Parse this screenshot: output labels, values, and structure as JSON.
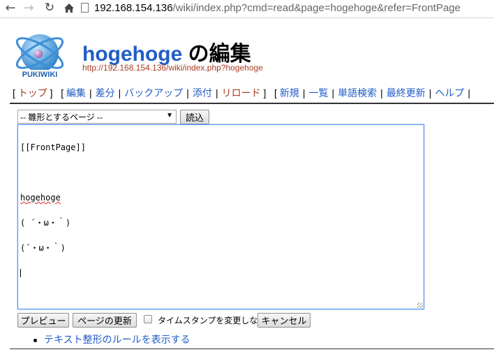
{
  "browser": {
    "url_host": "192.168.154.136",
    "url_rest": "/wiki/index.php?cmd=read&page=hogehoge&refer=FrontPage"
  },
  "header": {
    "page_name": "hogehoge",
    "title_suffix": " の編集",
    "page_url": "http://192.168.154.136/wiki/index.php?hogehoge",
    "logo_text": "PUKIWIKI"
  },
  "navigator": {
    "top": "トップ",
    "group1": [
      "編集",
      "差分",
      "バックアップ",
      "添付",
      "リロード"
    ],
    "group2": [
      "新規",
      "一覧",
      "単語検索",
      "最終更新",
      "ヘルプ"
    ]
  },
  "form": {
    "template_select": "-- 雛形とするページ --",
    "load_button": "読込",
    "textarea_lines": [
      "[[FrontPage]]",
      "",
      "hogehoge",
      "( ´・ω・｀)",
      "(´・ω・｀)"
    ],
    "preview_button": "プレビュー",
    "update_button": "ページの更新",
    "notimestamp_label": "タイムスタンプを変更しない",
    "cancel_button": "キャンセル"
  },
  "rules_link": "テキスト整形のルールを表示する",
  "colors": {
    "link": "#215dc6",
    "visited": "#a63d21",
    "focus": "#4d90fe"
  }
}
